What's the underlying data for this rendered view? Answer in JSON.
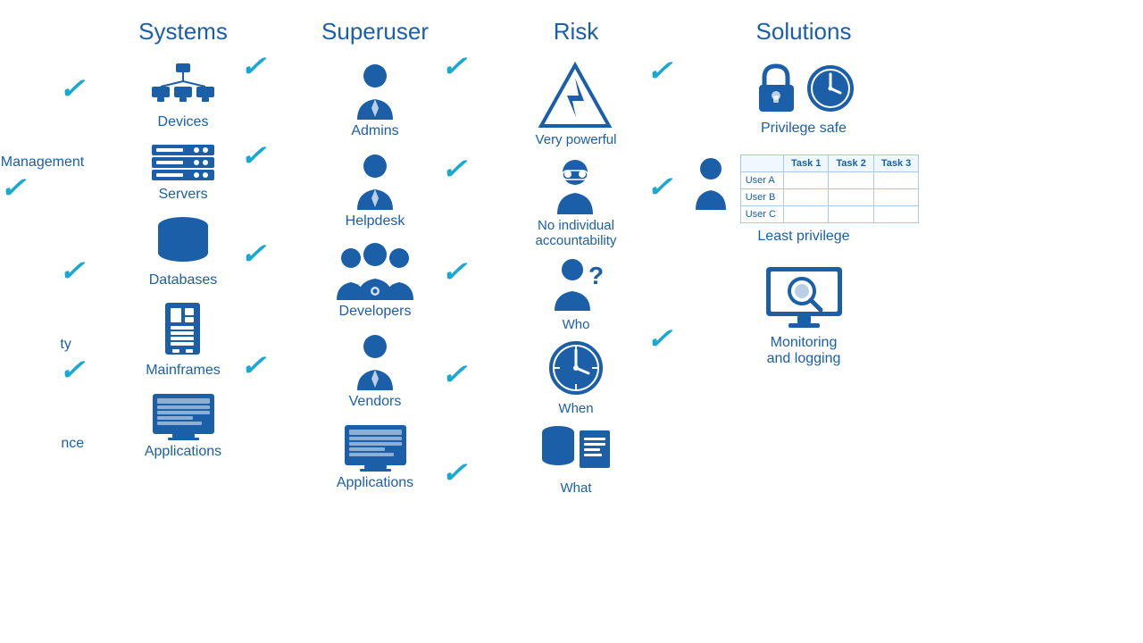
{
  "columns": {
    "left_partial": {
      "title": "",
      "items": [
        "Management",
        "ty",
        "nce"
      ]
    },
    "systems": {
      "title": "Systems",
      "items": [
        {
          "label": "Devices",
          "icon": "devices"
        },
        {
          "label": "Servers",
          "icon": "servers"
        },
        {
          "label": "Databases",
          "icon": "databases"
        },
        {
          "label": "Mainframes",
          "icon": "mainframes"
        },
        {
          "label": "Applications",
          "icon": "applications"
        }
      ]
    },
    "superuser": {
      "title": "Superuser",
      "items": [
        {
          "label": "Admins",
          "icon": "admins"
        },
        {
          "label": "Helpdesk",
          "icon": "helpdesk"
        },
        {
          "label": "Developers",
          "icon": "developers"
        },
        {
          "label": "Vendors",
          "icon": "vendors"
        },
        {
          "label": "Applications",
          "icon": "applications"
        }
      ]
    },
    "risk": {
      "title": "Risk",
      "items": [
        {
          "label": "Very powerful",
          "icon": "lightning"
        },
        {
          "label": "No individual accountability",
          "icon": "masked-person"
        },
        {
          "label": "Who",
          "icon": "person-question"
        },
        {
          "label": "When",
          "icon": "clock"
        },
        {
          "label": "What",
          "icon": "data"
        }
      ]
    },
    "solutions": {
      "title": "Solutions",
      "items": [
        {
          "label": "Privilege safe",
          "icon": "privilege-safe"
        },
        {
          "label": "Least privilege",
          "icon": "least-privilege"
        },
        {
          "label": "Monitoring and logging",
          "icon": "monitoring"
        }
      ],
      "table": {
        "headers": [
          "",
          "Task 1",
          "Task 2",
          "Task 3"
        ],
        "rows": [
          {
            "user": "User A",
            "t1": "",
            "t2": "",
            "t3": ""
          },
          {
            "user": "User B",
            "t1": "",
            "t2": "",
            "t3": ""
          },
          {
            "user": "User C",
            "t1": "",
            "t2": "",
            "t3": ""
          }
        ]
      }
    }
  }
}
